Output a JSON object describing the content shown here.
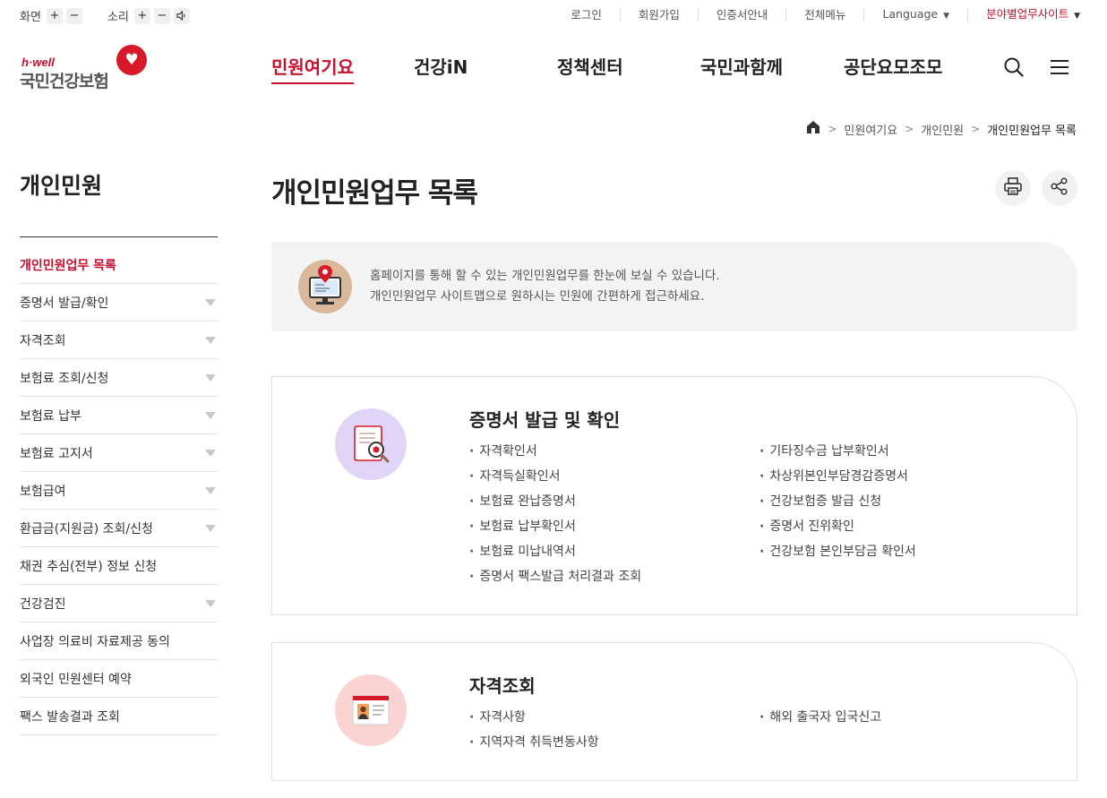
{
  "utility": {
    "screen_label": "화면",
    "sound_label": "소리",
    "plus": "+",
    "minus": "−",
    "speaker_icon": "speaker-icon",
    "links": [
      {
        "label": "로그인"
      },
      {
        "label": "회원가입"
      },
      {
        "label": "인증서안내"
      },
      {
        "label": "전체메뉴"
      },
      {
        "label": "Language"
      },
      {
        "label": "분야별업무사이트"
      }
    ],
    "accent": "#c8102e"
  },
  "logo": {
    "en": "h·well",
    "ko": "국민건강보험",
    "heart_glyph": "♥"
  },
  "nav": {
    "tabs": [
      {
        "label": "민원여기요",
        "active": true
      },
      {
        "label": "건강iN"
      },
      {
        "label": "정책센터"
      },
      {
        "label": "국민과함께"
      },
      {
        "label": "공단요모조모"
      }
    ],
    "search_icon": "search-icon",
    "menu_icon": "hamburger-menu-icon"
  },
  "breadcrumb": {
    "home_icon": "home-icon",
    "items": [
      "민원여기요",
      "개인민원",
      "개인민원업무 목록"
    ]
  },
  "sidebar": {
    "title": "개인민원",
    "items": [
      {
        "label": "개인민원업무 목록",
        "active": true
      },
      {
        "label": "증명서 발급/확인",
        "expandable": true
      },
      {
        "label": "자격조회",
        "expandable": true
      },
      {
        "label": "보험료 조회/신청",
        "expandable": true
      },
      {
        "label": "보험료 납부",
        "expandable": true
      },
      {
        "label": "보험료 고지서",
        "expandable": true
      },
      {
        "label": "보험급여",
        "expandable": true
      },
      {
        "label": "환급금(지원금) 조회/신청",
        "expandable": true
      },
      {
        "label": "채권 추심(전부) 정보 신청"
      },
      {
        "label": "건강검진",
        "expandable": true
      },
      {
        "label": "사업장 의료비 자료제공 동의"
      },
      {
        "label": "외국인 민원센터 예약"
      },
      {
        "label": "팩스 발송결과 조회"
      }
    ]
  },
  "main": {
    "title": "개인민원업무 목록",
    "print_icon": "print-icon",
    "share_icon": "share-icon",
    "info": {
      "icon": "monitor-location-pin-icon",
      "line1": "홈페이지를 통해 할 수 있는 개인민원업무를 한눈에 보실 수 있습니다.",
      "line2": "개인민원업무 사이트맵으로 원하시는 민원에 간편하게 접근하세요."
    },
    "cards": [
      {
        "title": "증명서 발급 및 확인",
        "icon": "certificate-magnifier-icon",
        "icon_bg": "#e1d5f7",
        "left": [
          "자격확인서",
          "자격득실확인서",
          "보험료 완납증명서",
          "보험료 납부확인서",
          "보험료 미납내역서",
          "증명서 팩스발급 처리결과 조회"
        ],
        "right": [
          "기타징수금 납부확인서",
          "차상위본인부담경감증명서",
          "건강보험증 발급 신청",
          "증명서 진위확인",
          "건강보험 본인부담금 확인서"
        ]
      },
      {
        "title": "자격조회",
        "icon": "id-card-icon",
        "icon_bg": "#fcd3d3",
        "left": [
          "자격사항",
          "지역자격 취득변동사항"
        ],
        "right": [
          "해외 출국자 입국신고"
        ]
      }
    ]
  }
}
